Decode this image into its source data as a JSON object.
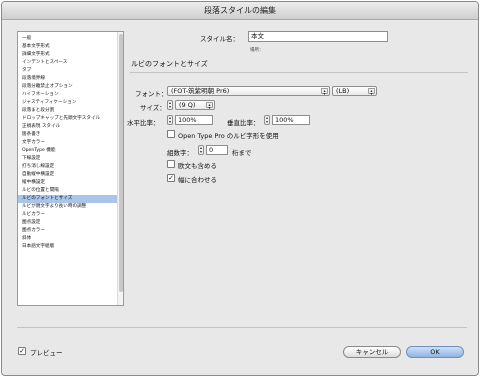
{
  "window": {
    "title": "段落スタイルの編集"
  },
  "style_name": {
    "label": "スタイル名：",
    "value": "本文",
    "location_label": "場所："
  },
  "section": {
    "title": "ルビのフォントとサイズ"
  },
  "sidebar": {
    "items": [
      "一般",
      "基本文字形式",
      "詳細文字形式",
      "インデントとスペース",
      "タブ",
      "段落境界線",
      "段落分離禁止オプション",
      "ハイフネーション",
      "ジャスティフィケーション",
      "段落まと段分割",
      "ドロップキャップと先頭文字スタイル",
      "正規表現 スタイル",
      "箇条書き",
      "文字カラー",
      "OpenType 機能",
      "下線設定",
      "打ち消し線設定",
      "自動縦中横設定",
      "縦中横設定",
      "ルビの位置と間隔",
      "ルビのフォントとサイズ",
      "ルビが親文字より長い時の調整",
      "ルビカラー",
      "圏点設定",
      "圏点カラー",
      "斜体",
      "日本語文字組版"
    ],
    "selected_index": 20
  },
  "font": {
    "label": "フォント：",
    "family": "(FOT-筑紫明朝 Pr6)",
    "style": "(LB)"
  },
  "size": {
    "label": "サイズ：",
    "value": "(9 Q)"
  },
  "h_scale": {
    "label": "水平比率：",
    "value": "100%"
  },
  "v_scale": {
    "label": "垂直比率：",
    "value": "100%"
  },
  "opentype": {
    "label": "Open Type Pro のルビ字形を使用",
    "checked": false
  },
  "digits": {
    "label": "組数字：",
    "value": "0",
    "suffix": "桁まで"
  },
  "include_roman": {
    "label": "欧文も含める",
    "checked": false
  },
  "fit_width": {
    "label": "幅に合わせる",
    "checked": true
  },
  "preview": {
    "label": "プレビュー",
    "checked": true
  },
  "buttons": {
    "cancel": "キャンセル",
    "ok": "OK"
  }
}
